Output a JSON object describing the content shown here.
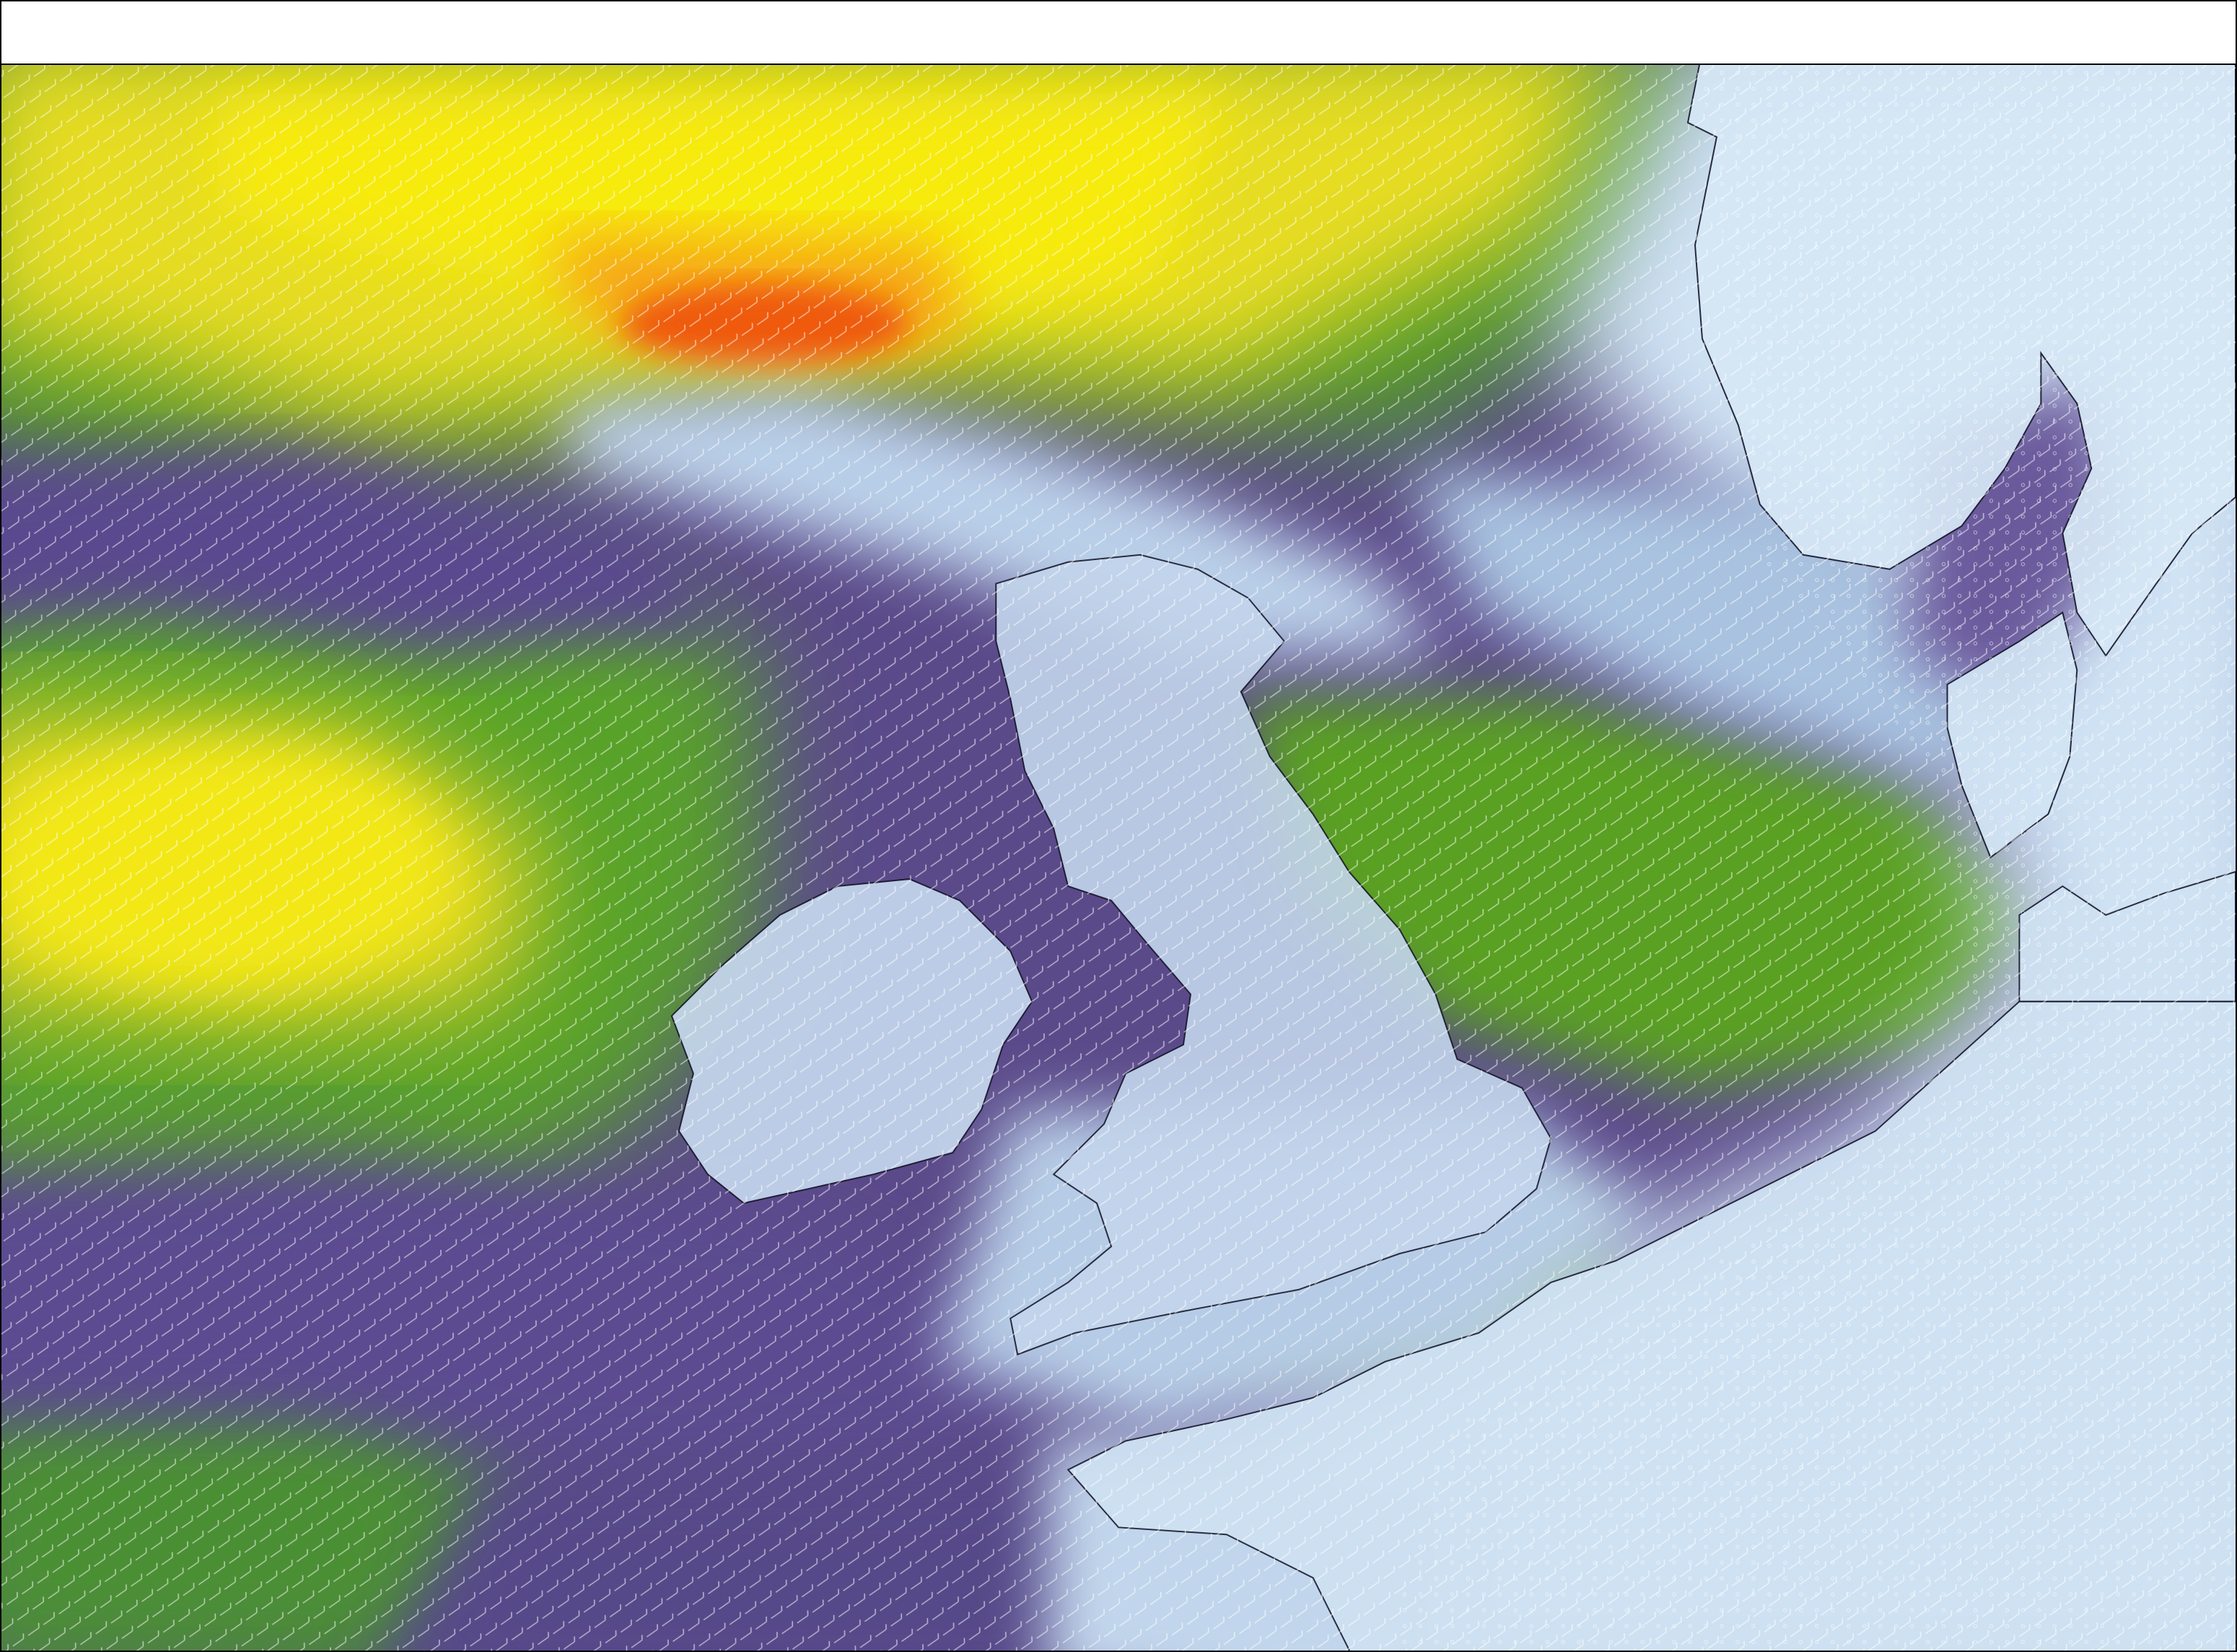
{
  "map": {
    "kind": "wind-speed-field",
    "region": "north-east-atlantic-and-north-sea",
    "colors": {
      "calm": "#d8ecf8",
      "light": "#a9c6e2",
      "moderate": "#5a4a8c",
      "fresh": "#4e9a2a",
      "strong": "#f2e41a",
      "gale": "#ef5a10",
      "barb": "#ffffff",
      "coastline": "#1a1a2e"
    },
    "layers": [
      "wind-speed-shading",
      "wind-barbs",
      "coastline"
    ]
  }
}
